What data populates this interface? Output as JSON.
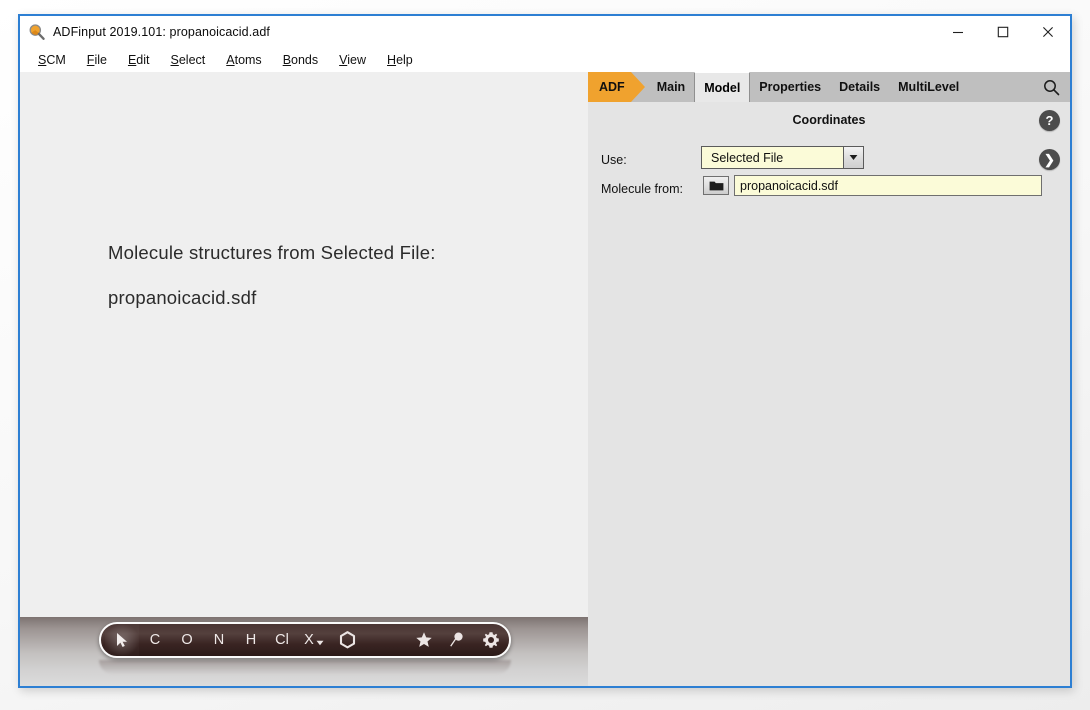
{
  "window": {
    "title": "ADFinput 2019.101: propanoicacid.adf",
    "icon": "magnifier-icon",
    "controls": {
      "minimize": "─",
      "maximize": "□",
      "close": "✕"
    }
  },
  "menubar": {
    "items": [
      {
        "mnemonic": "S",
        "rest": "CM"
      },
      {
        "mnemonic": "F",
        "rest": "ile"
      },
      {
        "mnemonic": "E",
        "rest": "dit"
      },
      {
        "mnemonic": "S",
        "rest": "elect"
      },
      {
        "mnemonic": "A",
        "rest": "toms"
      },
      {
        "mnemonic": "B",
        "rest": "onds"
      },
      {
        "mnemonic": "V",
        "rest": "iew"
      },
      {
        "mnemonic": "H",
        "rest": "elp"
      }
    ]
  },
  "canvas": {
    "line1": "Molecule structures from Selected File:",
    "line2": "propanoicacid.sdf"
  },
  "atom_toolbar": {
    "items": [
      {
        "name": "cursor-tool",
        "label": "",
        "icon": "cursor-arrow-icon",
        "selected": true
      },
      {
        "name": "carbon-tool",
        "label": "C",
        "icon": "",
        "selected": false
      },
      {
        "name": "oxygen-tool",
        "label": "O",
        "icon": "",
        "selected": false
      },
      {
        "name": "nitrogen-tool",
        "label": "N",
        "icon": "",
        "selected": false
      },
      {
        "name": "hydrogen-tool",
        "label": "H",
        "icon": "",
        "selected": false
      },
      {
        "name": "chlorine-tool",
        "label": "Cl",
        "icon": "",
        "selected": false
      },
      {
        "name": "other-element-tool",
        "label": "X",
        "icon": "chevron-down-icon",
        "selected": false
      },
      {
        "name": "benzene-ring-tool",
        "label": "",
        "icon": "hexagon-icon",
        "selected": false
      }
    ],
    "right_items": [
      {
        "name": "favorites-tool",
        "icon": "star-icon"
      },
      {
        "name": "magnifier-tool",
        "icon": "magnifier-pin-icon"
      },
      {
        "name": "settings-tool",
        "icon": "gear-icon"
      }
    ]
  },
  "tabs": {
    "items": [
      {
        "label": "ADF",
        "active": false,
        "style": "brand"
      },
      {
        "label": "Main",
        "active": false,
        "style": "normal"
      },
      {
        "label": "Model",
        "active": true,
        "style": "normal"
      },
      {
        "label": "Properties",
        "active": false,
        "style": "normal"
      },
      {
        "label": "Details",
        "active": false,
        "style": "normal"
      },
      {
        "label": "MultiLevel",
        "active": false,
        "style": "normal"
      }
    ],
    "search_icon": "search-icon"
  },
  "panel": {
    "section_title": "Coordinates",
    "help_button": "?",
    "next_button": "❯",
    "use": {
      "label": "Use:",
      "value": "Selected File",
      "arrow": "▼"
    },
    "molecule_from": {
      "label": "Molecule from:",
      "browse_icon": "folder-icon",
      "value": "propanoicacid.sdf",
      "placeholder": ""
    }
  },
  "colors": {
    "brand_orange": "#f0a22e",
    "window_border": "#2d7fd3",
    "panel_bg": "#e4e4e4",
    "canvas_bg": "#efefef",
    "field_yellow": "#fbfbd8"
  }
}
